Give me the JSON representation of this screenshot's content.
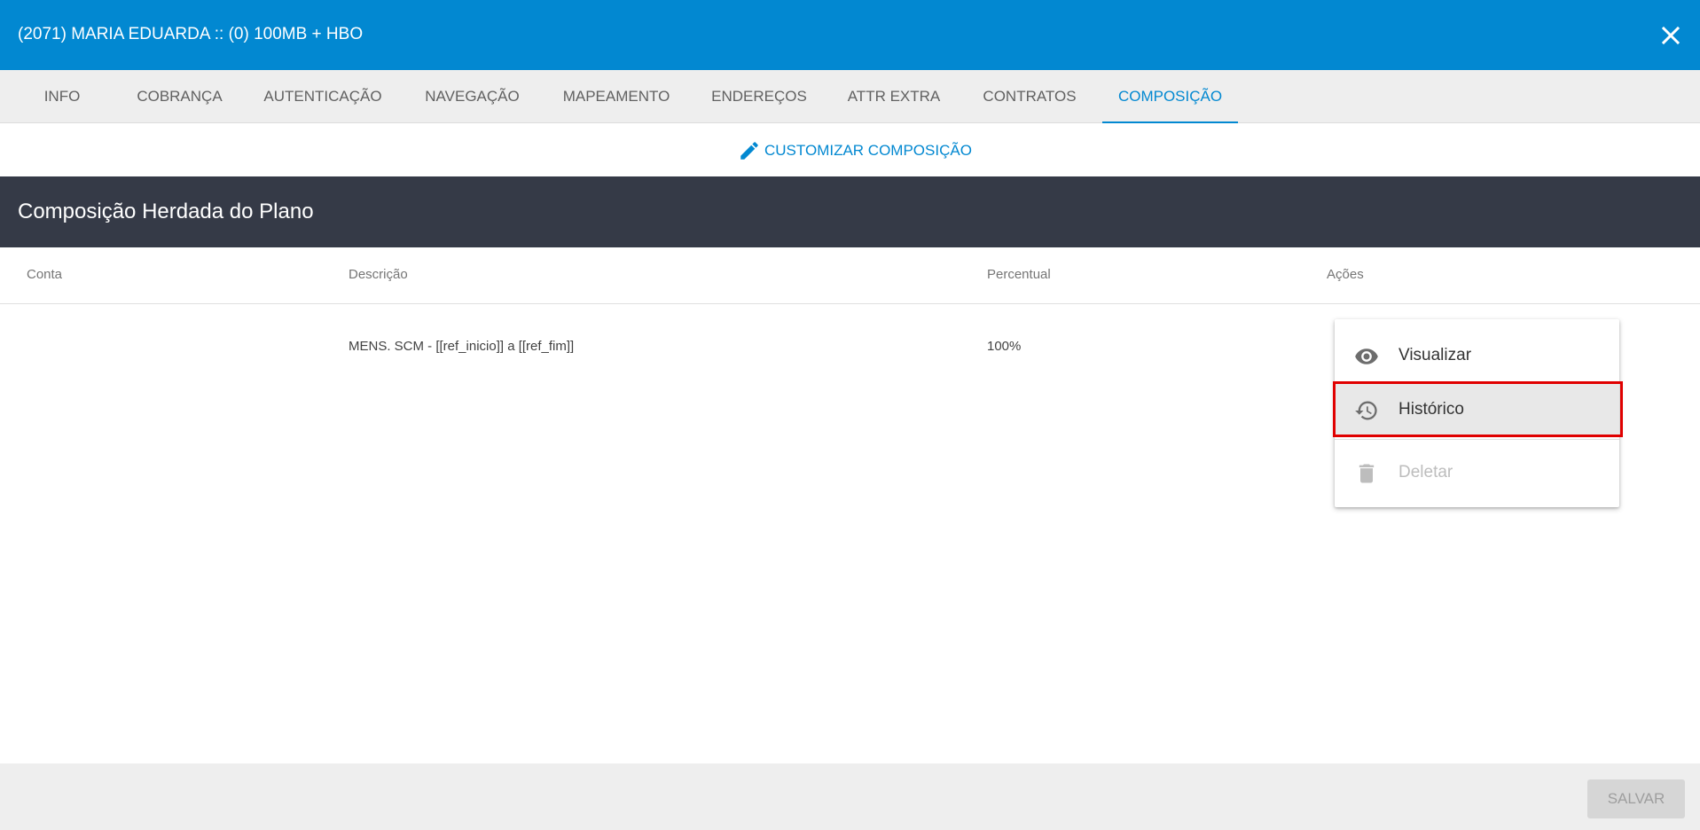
{
  "header": {
    "title": "(2071) MARIA EDUARDA :: (0) 100MB + HBO",
    "close_icon": "close-icon"
  },
  "tabs": [
    {
      "label": "INFO"
    },
    {
      "label": "COBRANÇA"
    },
    {
      "label": "AUTENTICAÇÃO"
    },
    {
      "label": "NAVEGAÇÃO"
    },
    {
      "label": "MAPEAMENTO"
    },
    {
      "label": "ENDEREÇOS"
    },
    {
      "label": "ATTR EXTRA"
    },
    {
      "label": "CONTRATOS"
    },
    {
      "label": "COMPOSIÇÃO",
      "active": true
    }
  ],
  "customize": {
    "label": "CUSTOMIZAR COMPOSIÇÃO",
    "icon": "pencil-icon"
  },
  "section": {
    "title": "Composição Herdada do Plano"
  },
  "table": {
    "columns": [
      "Conta",
      "Descrição",
      "Percentual",
      "Ações"
    ],
    "rows": [
      {
        "conta": "",
        "descricao": "MENS. SCM - [[ref_inicio]] a [[ref_fim]]",
        "percentual": "100%"
      }
    ]
  },
  "menu": {
    "items": [
      {
        "label": "Visualizar",
        "icon": "eye-icon"
      },
      {
        "label": "Histórico",
        "icon": "history-icon",
        "highlighted": true
      },
      {
        "label": "Deletar",
        "icon": "trash-icon",
        "disabled": true
      }
    ]
  },
  "footer": {
    "save_label": "SALVAR"
  },
  "colors": {
    "primary": "#0288d1",
    "section_bar": "#353a47",
    "highlight_border": "#e00000"
  }
}
